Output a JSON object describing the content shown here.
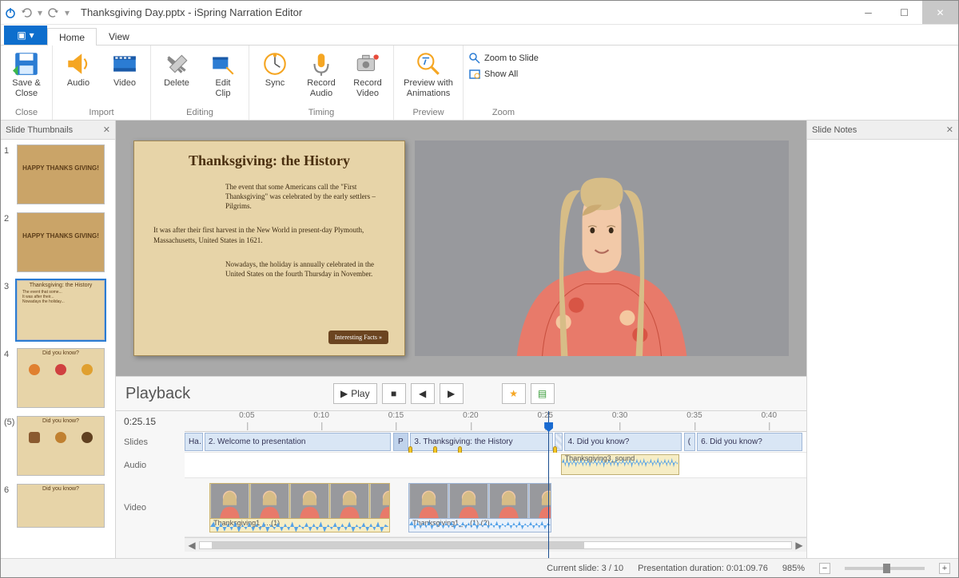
{
  "title": "Thanksgiving Day.pptx - iSpring Narration Editor",
  "tabs": {
    "file": "⬛ ▾",
    "home": "Home",
    "view": "View"
  },
  "ribbon": {
    "saveClose": "Save &\nClose",
    "audio": "Audio",
    "video": "Video",
    "delete": "Delete",
    "editClip": "Edit\nClip",
    "sync": "Sync",
    "recAudio": "Record\nAudio",
    "recVideo": "Record\nVideo",
    "preview": "Preview with\nAnimations",
    "zoomSlide": "Zoom to Slide",
    "showAll": "Show All",
    "groups": {
      "close": "Close",
      "import": "Import",
      "editing": "Editing",
      "timing": "Timing",
      "preview": "Preview",
      "zoom": "Zoom"
    }
  },
  "panels": {
    "thumbs": "Slide Thumbnails",
    "notes": "Slide Notes"
  },
  "thumbs": [
    {
      "n": "1",
      "title": "HAPPY THANKS GIVING!"
    },
    {
      "n": "2",
      "title": "HAPPY THANKS GIVING!"
    },
    {
      "n": "3",
      "title": "Thanksgiving: the History",
      "selected": true
    },
    {
      "n": "4",
      "title": "Did you know?"
    },
    {
      "n": "(5)",
      "title": "Did you know?"
    },
    {
      "n": "6",
      "title": "Did you know?"
    }
  ],
  "slide": {
    "heading": "Thanksgiving: the History",
    "p1": "The event that some Americans call the \"First Thanksgiving\" was celebrated by the early settlers – Pilgrims.",
    "p2": "It was after their first harvest in the New World in present-day Plymouth, Massachusetts, United States in 1621.",
    "p3": "Nowadays, the holiday is annually celebrated in the United States on the fourth Thursday in November.",
    "btn": "Interesting Facts »"
  },
  "playback": {
    "title": "Playback",
    "play": "Play",
    "time": "0:25.15",
    "tracks": {
      "slides": "Slides",
      "audio": "Audio",
      "video": "Video"
    }
  },
  "ruler": [
    "0:05",
    "0:10",
    "0:15",
    "0:20",
    "0:25",
    "0:30",
    "0:35",
    "0:40"
  ],
  "slideClips": {
    "c1": "Ha…",
    "c2": "2. Welcome to presentation",
    "cp": "P",
    "c3": "3. Thanksgiving: the History",
    "c4": "4. Did you know?",
    "c5": "(",
    "c6": "6. Did you know?"
  },
  "audioClip": {
    "label": "Thanksgiving3_sound"
  },
  "videoClips": {
    "v1": "Thanksgiving1_…(1)",
    "v2": "Thanksgiving1_…(1) (2)"
  },
  "status": {
    "curSlide": "Current slide: 3 / 10",
    "duration": "Presentation duration: 0:01:09.76",
    "zoom": "985%"
  }
}
